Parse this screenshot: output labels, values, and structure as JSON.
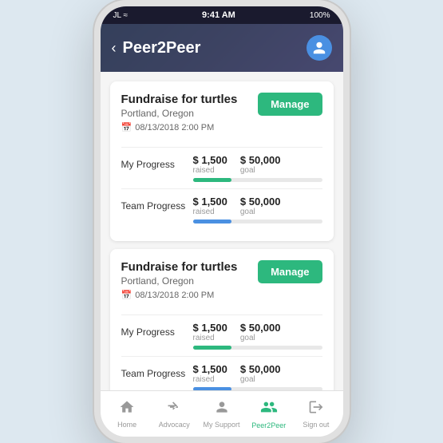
{
  "statusBar": {
    "carrier": "JL ≈",
    "time": "9:41 AM",
    "battery": "100%"
  },
  "header": {
    "title": "Peer2Peer",
    "backLabel": "‹"
  },
  "campaigns": [
    {
      "title": "Fundraise for turtles",
      "location": "Portland, Oregon",
      "date": "08/13/2018  2:00 PM",
      "manageLabel": "Manage",
      "myProgress": {
        "label": "My Progress",
        "raised": "$ 1,500",
        "raisedLabel": "raised",
        "goal": "$ 50,000",
        "goalLabel": "goal"
      },
      "teamProgress": {
        "label": "Team Progress",
        "raised": "$ 1,500",
        "raisedLabel": "raised",
        "goal": "$ 50,000",
        "goalLabel": "goal"
      }
    },
    {
      "title": "Fundraise for turtles",
      "location": "Portland, Oregon",
      "date": "08/13/2018  2:00 PM",
      "manageLabel": "Manage",
      "myProgress": {
        "label": "My Progress",
        "raised": "$ 1,500",
        "raisedLabel": "raised",
        "goal": "$ 50,000",
        "goalLabel": "goal"
      },
      "teamProgress": {
        "label": "Team Progress",
        "raised": "$ 1,500",
        "raisedLabel": "raised",
        "goal": "$ 50,000",
        "goalLabel": "goal"
      }
    }
  ],
  "nav": {
    "items": [
      {
        "icon": "⌂",
        "label": "Home",
        "active": false
      },
      {
        "icon": "📣",
        "label": "Advocacy",
        "active": false
      },
      {
        "icon": "👤",
        "label": "My Support",
        "active": false
      },
      {
        "icon": "👥",
        "label": "Peer2Peer",
        "active": true
      },
      {
        "icon": "→",
        "label": "Sign out",
        "active": false
      }
    ]
  }
}
